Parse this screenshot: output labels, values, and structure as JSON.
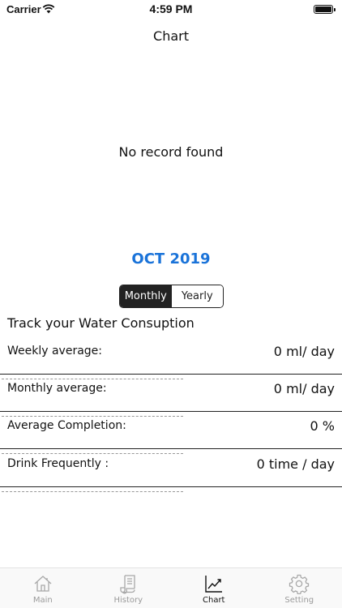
{
  "status_bar": {
    "carrier": "Carrier",
    "time": "4:59 PM"
  },
  "nav": {
    "title": "Chart"
  },
  "chart": {
    "empty_message": "No record found"
  },
  "period": {
    "label": "OCT 2019"
  },
  "segmented": {
    "options": [
      {
        "label": "Monthly",
        "selected": true
      },
      {
        "label": "Yearly",
        "selected": false
      }
    ]
  },
  "stats": {
    "title": "Track your Water Consuption",
    "rows": [
      {
        "label": "Weekly average:",
        "value": "0 ml/ day"
      },
      {
        "label": "Monthly average:",
        "value": "0 ml/ day"
      },
      {
        "label": "Average Completion:",
        "value": "0 %"
      },
      {
        "label": "Drink Frequently :",
        "value": "0 time / day"
      }
    ]
  },
  "tab_bar": {
    "items": [
      {
        "label": "Main",
        "icon": "home-icon",
        "active": false
      },
      {
        "label": "History",
        "icon": "scroll-icon",
        "active": false
      },
      {
        "label": "Chart",
        "icon": "chart-line-icon",
        "active": true
      },
      {
        "label": "Setting",
        "icon": "gear-icon",
        "active": false
      }
    ]
  },
  "colors": {
    "accent": "#1a73d9",
    "segment_active": "#222222",
    "tab_inactive": "#9a9a9a"
  }
}
